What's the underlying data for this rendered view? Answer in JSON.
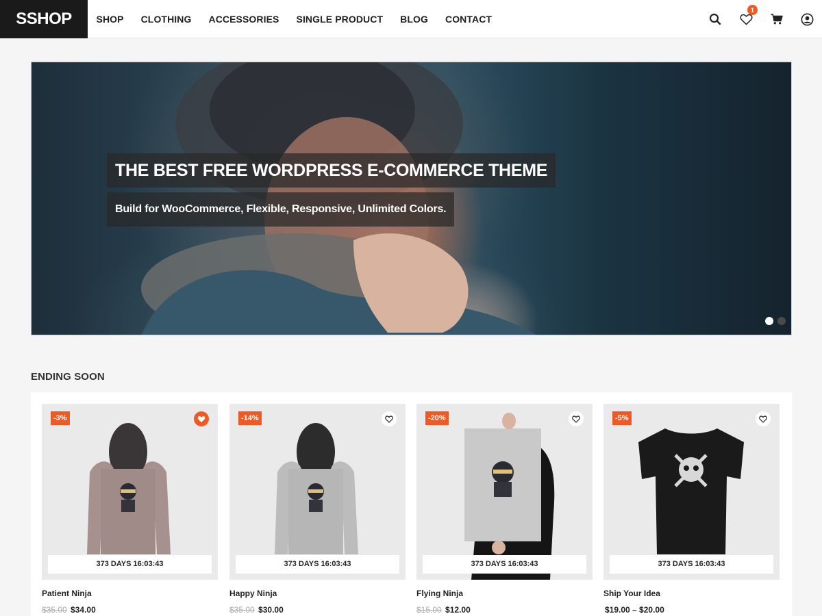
{
  "brand": {
    "logo": "SSHOP"
  },
  "nav": {
    "items": [
      "SHOP",
      "CLOTHING",
      "ACCESSORIES",
      "SINGLE PRODUCT",
      "BLOG",
      "CONTACT"
    ]
  },
  "header_icons": {
    "search": "search-icon",
    "wishlist": "heart-icon",
    "wishlist_count": "1",
    "cart": "cart-icon",
    "account": "user-icon"
  },
  "hero": {
    "title": "THE BEST FREE WORDPRESS E-COMMERCE THEME",
    "subtitle": "Build for WooCommerce, Flexible, Responsive, Unlimited Colors.",
    "slides": 2,
    "active_slide": 1
  },
  "section": {
    "title": "ENDING SOON"
  },
  "products": [
    {
      "name": "Patient Ninja",
      "discount": "-3%",
      "countdown": "373 DAYS 16:03:43",
      "old_price": "$35.00",
      "price": "$34.00",
      "wishlisted": true,
      "image": "pink hoodie with ninja"
    },
    {
      "name": "Happy Ninja",
      "discount": "-14%",
      "countdown": "373 DAYS 16:03:43",
      "old_price": "$35.00",
      "price": "$30.00",
      "wishlisted": false,
      "image": "grey hoodie with ninja"
    },
    {
      "name": "Flying Ninja",
      "discount": "-20%",
      "countdown": "373 DAYS 16:03:43",
      "old_price": "$15.00",
      "price": "$12.00",
      "wishlisted": false,
      "image": "poster with ninja"
    },
    {
      "name": "Ship Your Idea",
      "discount": "-5%",
      "countdown": "373 DAYS 16:03:43",
      "old_price": "",
      "price": "$19.00 – $20.00",
      "wishlisted": false,
      "image": "black t-shirt"
    }
  ],
  "colors": {
    "accent": "#ef5a24",
    "logo_bg": "#1a1a1a",
    "page_bg": "#f5f5f5"
  }
}
